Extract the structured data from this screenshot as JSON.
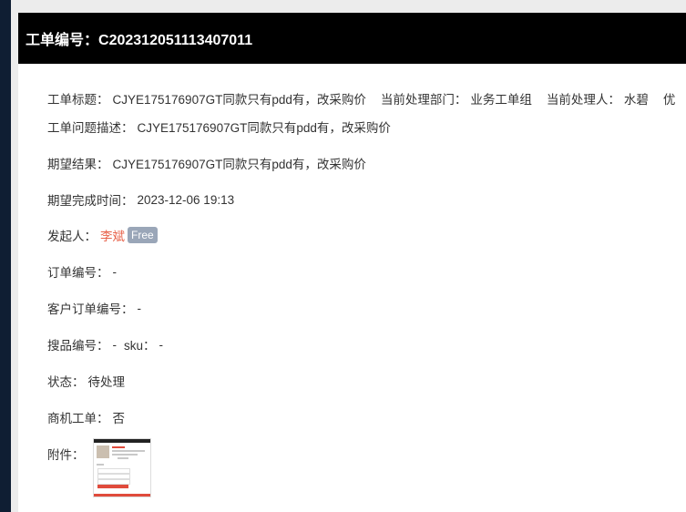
{
  "ticket": {
    "header_label": "工单编号：",
    "header_value": "C202312051113407011"
  },
  "fields": {
    "title_label": "工单标题：",
    "title_value": "CJYE175176907GT同款只有pdd有，改采购价",
    "dept_label": "当前处理部门：",
    "dept_value": "业务工单组",
    "handler_label": "当前处理人：",
    "handler_value": "水碧",
    "overflow_text": "优",
    "desc_label": "工单问题描述：",
    "desc_value": "CJYE175176907GT同款只有pdd有，改采购价",
    "expect_label": "期望结果：",
    "expect_value": "CJYE175176907GT同款只有pdd有，改采购价",
    "deadline_label": "期望完成时间：",
    "deadline_value": "2023-12-06 19:13",
    "initiator_label": "发起人：",
    "initiator_name": "李斌",
    "initiator_badge": "Free",
    "order_label": "订单编号：",
    "order_value": "-",
    "customer_order_label": "客户订单编号：",
    "customer_order_value": "-",
    "search_label": "搜品编号：",
    "search_value": "-",
    "sku_label": "sku：",
    "sku_value": "-",
    "status_label": "状态：",
    "status_value": "待处理",
    "biz_label": "商机工单：",
    "biz_value": "否",
    "attachment_label": "附件："
  },
  "colors": {
    "header_bg": "#000000",
    "link": "#e8624a",
    "badge_bg": "#9aa6b8",
    "sidebar": "#0f1e33"
  }
}
